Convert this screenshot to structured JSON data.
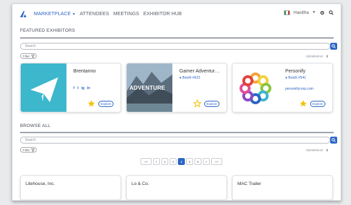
{
  "nav": {
    "items": [
      {
        "label": "MARKETPLACE",
        "active": true
      },
      {
        "label": "ATTENDEES",
        "active": false
      },
      {
        "label": "MEETINGS",
        "active": false
      },
      {
        "label": "EXHIBITOR HUB",
        "active": false
      }
    ],
    "user_name": "Hasitha",
    "accent_color": "#2c65c4"
  },
  "featured": {
    "title": "FEATURED EXHIBITORS",
    "search_placeholder": "Search",
    "filter_label": "Filter",
    "sort_label": "Alphabetical",
    "explore_label": "Explore",
    "cards": [
      {
        "name": "Brentanno",
        "booth": "",
        "url": "",
        "image_text": "",
        "socials": [
          "f",
          "t",
          "ig",
          "in"
        ],
        "favorited": true
      },
      {
        "name": "Garner Adventur…",
        "booth": "Booth #623",
        "url": "",
        "image_text": "ADVENTURE",
        "socials": [],
        "favorited": false
      },
      {
        "name": "Personify",
        "booth": "Booth #541",
        "url": "personifycorp.com",
        "image_text": "",
        "socials": [],
        "favorited": true
      }
    ]
  },
  "browse": {
    "title": "BROWSE ALL",
    "search_placeholder": "Search",
    "filter_label": "Filter",
    "sort_label": "Alphabetical",
    "pagination": {
      "first": "<<",
      "prev": "<",
      "pages": [
        "2",
        "3",
        "4",
        "5",
        "6"
      ],
      "current": "4",
      "next": ">",
      "last": ">>"
    },
    "cards": [
      {
        "name": "Litehouse, Inc."
      },
      {
        "name": "Lo & Co."
      },
      {
        "name": "MAC Trailer"
      }
    ]
  }
}
